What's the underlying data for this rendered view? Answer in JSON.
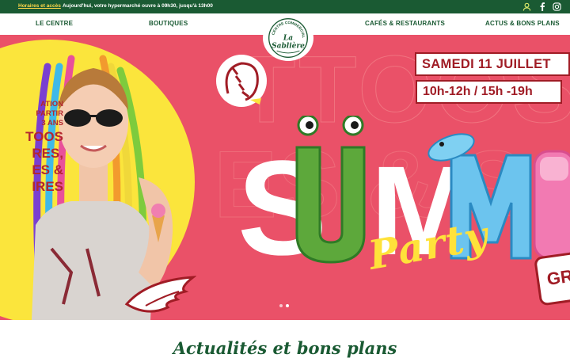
{
  "topbar": {
    "hours_link": "Horaires et accès",
    "message": "Aujourd'hui, votre hypermarché ouvre à 09h30, jusqu'à 13h00",
    "icons": [
      "user-icon",
      "facebook-icon",
      "instagram-icon"
    ]
  },
  "nav": {
    "items": [
      "LE CENTRE",
      "BOUTIQUES",
      "CAFÉS & RESTAURANTS",
      "ACTUS & BONS PLANS"
    ]
  },
  "logo": {
    "top_arc": "CENTRE COMMERCIAL",
    "line1": "La",
    "line2": "Sablière"
  },
  "hero": {
    "left_text": [
      "ATION",
      "PARTIR",
      "3 ANS",
      "TOOS",
      "RES,",
      "ES &",
      "IRES"
    ],
    "date": "SAMEDI 11 JUILLET",
    "hours": "10h-12h / 15h -19h",
    "summer_letters": [
      "S",
      "U",
      "M",
      "M",
      "E"
    ],
    "party": "Party",
    "badge": "GR",
    "slides": 2,
    "active_slide": 2
  },
  "section": {
    "title": "Actualités et bons plans"
  },
  "colors": {
    "brand_green": "#1a5a33",
    "hero_pink": "#ea5168",
    "accent_red": "#a01c25",
    "accent_yellow": "#fbe53c"
  }
}
